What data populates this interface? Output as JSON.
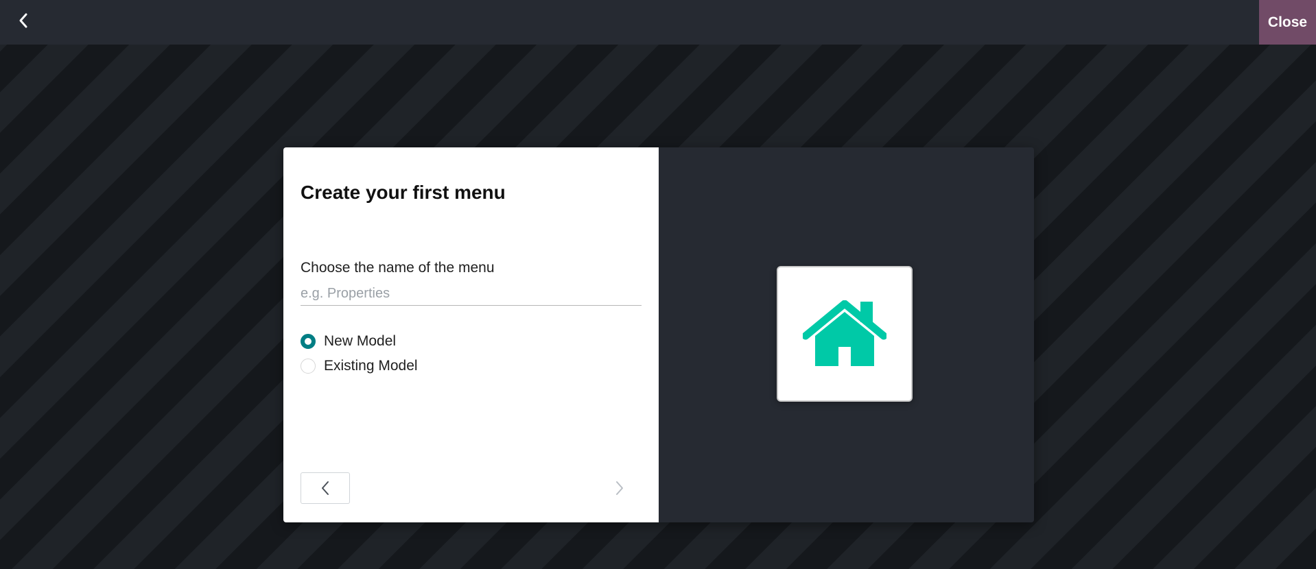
{
  "topbar": {
    "close_label": "Close",
    "back_icon": "chevron-left-icon"
  },
  "dialog": {
    "title": "Create your first menu",
    "field_label": "Choose the name of the menu",
    "input_value": "",
    "input_placeholder": "e.g. Properties",
    "options": [
      {
        "label": "New Model",
        "checked": true
      },
      {
        "label": "Existing Model",
        "checked": false
      }
    ],
    "prev_icon": "chevron-left-icon",
    "next_icon": "chevron-right-icon",
    "preview_icon": "house-icon",
    "accent_color": "#017e84",
    "icon_color": "#00c9a7",
    "close_color": "#714b67"
  }
}
